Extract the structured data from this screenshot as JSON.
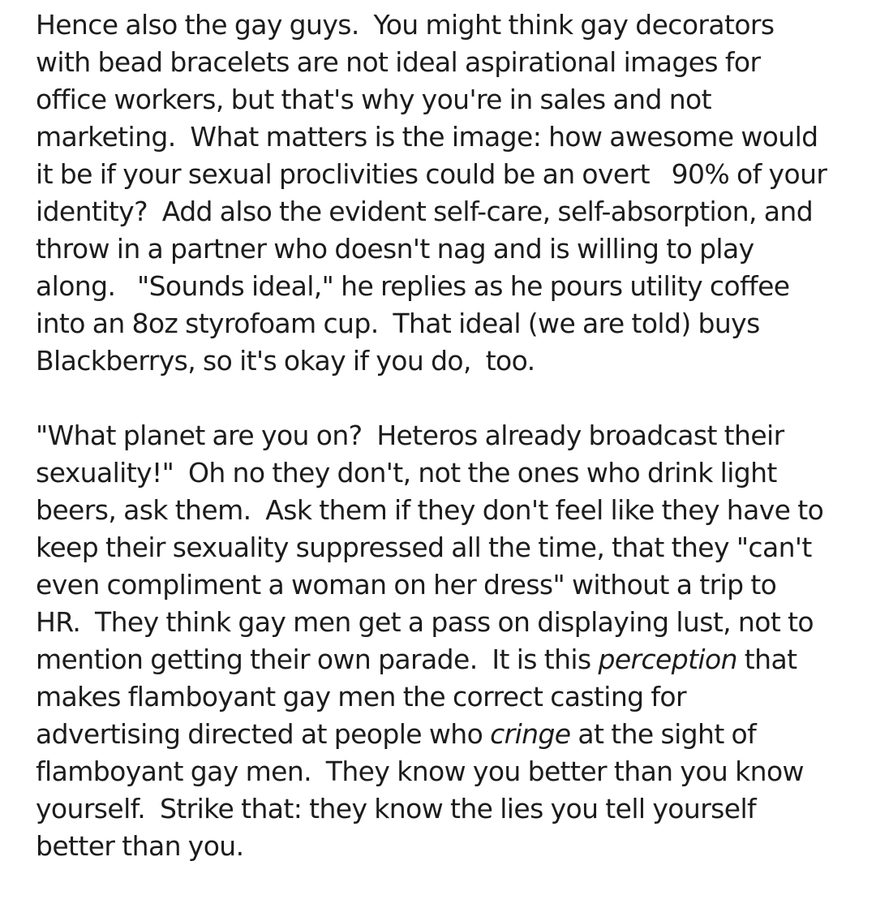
{
  "document": {
    "paragraphs": [
      {
        "lines": [
          [
            "Hence also the gay guys.  You might think gay decorators"
          ],
          [
            "with bead bracelets are not ideal aspirational images for"
          ],
          [
            "office workers, but that's why you're in sales and not"
          ],
          [
            "marketing.  What matters is the image: how awesome would"
          ],
          [
            "it be if your sexual proclivities could be an overt   90% of your"
          ],
          [
            "identity?  Add also the evident self-care, self-absorption, and"
          ],
          [
            "throw in a partner who doesn't nag and is willing to play"
          ],
          [
            "along.   \"Sounds ideal,\" he replies as he pours utility coffee"
          ],
          [
            "into an 8oz styrofoam cup.  That ideal (we are told) buys"
          ],
          [
            "Blackberrys, so it's okay if you do,  too."
          ]
        ]
      },
      {
        "lines": [
          [
            "\"What planet are you on?  Heteros already broadcast their"
          ],
          [
            "sexuality!\"  Oh no they don't, not the ones who drink light"
          ],
          [
            "beers, ask them.  Ask them if they don't feel like they have to"
          ],
          [
            "keep their sexuality suppressed all the time, that they \"can't"
          ],
          [
            "even compliment a woman on her dress\" without a trip to"
          ],
          [
            "HR.  They think gay men get a pass on displaying lust, not to"
          ],
          [
            "mention getting their own parade.  It is this ",
            "perception",
            " that"
          ],
          [
            "makes flamboyant gay men the correct casting for"
          ],
          [
            "advertising directed at people who ",
            "cringe",
            " at the sight of"
          ],
          [
            "flamboyant gay men.  They know you better than you know"
          ],
          [
            "yourself.  Strike that: they know the lies you tell yourself"
          ],
          [
            "better than you."
          ]
        ]
      }
    ]
  }
}
